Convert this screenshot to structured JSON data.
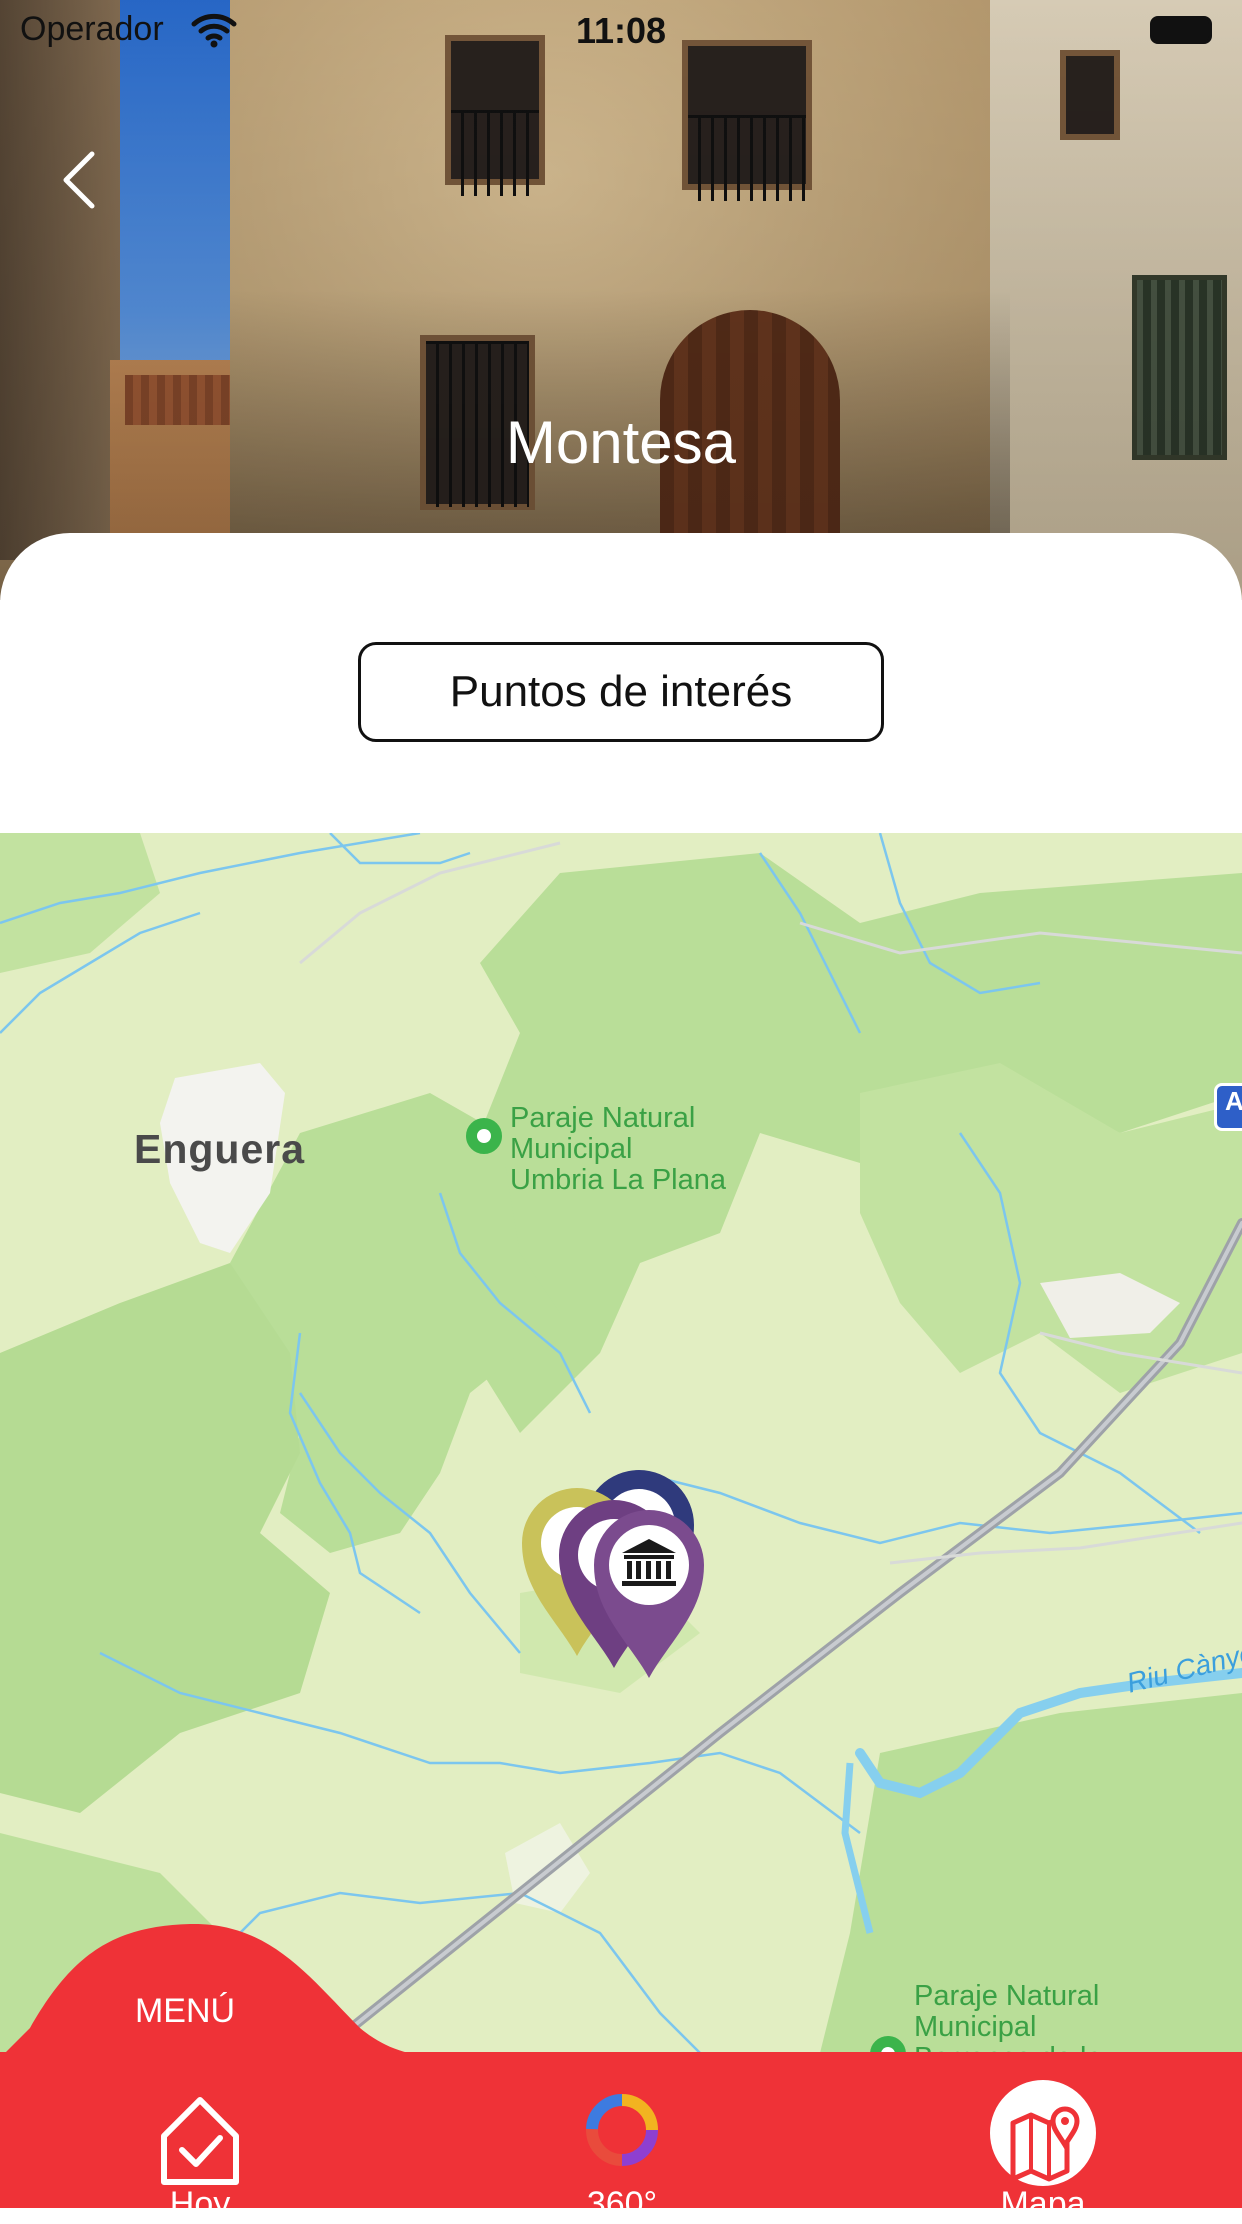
{
  "status_bar": {
    "carrier": "Operador",
    "time": "11:08"
  },
  "hero": {
    "title": "Montesa"
  },
  "actions": {
    "poi_button": "Puntos de interés"
  },
  "map": {
    "town": "Enguera",
    "park_1": [
      "Paraje Natural",
      "Municipal",
      "Umbria La Plana"
    ],
    "park_2": [
      "Paraje Natural",
      "Municipal",
      "Barranco de la"
    ],
    "river": "Riu Cànyoles",
    "road_badge": "A"
  },
  "bottom_nav": {
    "menu_label": "MENÚ",
    "items": [
      {
        "label": "Hoy",
        "icon": "home-check-icon"
      },
      {
        "label": "360°",
        "icon": "360-ring-icon"
      },
      {
        "label": "Mapa",
        "icon": "map-pin-icon",
        "selected": true
      }
    ]
  },
  "colors": {
    "accent": "#ef3237",
    "park_green": "#3bb44b",
    "pin_purple": "#7b4b8e",
    "pin_yellow": "#c9c25a",
    "pin_navy": "#2f3a7c"
  }
}
